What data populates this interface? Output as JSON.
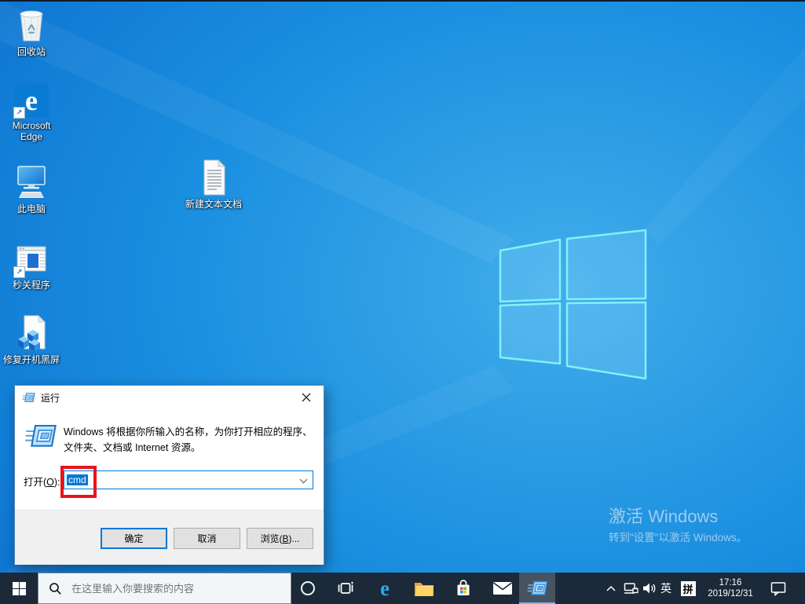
{
  "desktop": {
    "icons": [
      {
        "id": "recycle-bin",
        "label": "回收站"
      },
      {
        "id": "microsoft-edge",
        "label": "Microsoft Edge"
      },
      {
        "id": "this-pc",
        "label": "此电脑"
      },
      {
        "id": "seconds-close-app",
        "label": "秒关程序"
      },
      {
        "id": "fix-boot-black-screen",
        "label": "修复开机黑屏"
      },
      {
        "id": "new-text-document",
        "label": "新建文本文档"
      }
    ],
    "activation_watermark": {
      "line1": "激活 Windows",
      "line2": "转到\"设置\"以激活 Windows。"
    }
  },
  "run_dialog": {
    "title": "运行",
    "message_line1": "Windows 将根据你所输入的名称，为你打开相应的程序、",
    "message_line2": "文件夹、文档或 Internet 资源。",
    "open_label": {
      "prefix": "打开(",
      "key": "O",
      "suffix": "):"
    },
    "input_value": "cmd",
    "buttons": {
      "ok": "确定",
      "cancel": "取消",
      "browse": {
        "prefix": "浏览(",
        "key": "B",
        "suffix": ")..."
      }
    },
    "accent_color": "#0078d7",
    "annotation_color": "#e8151b"
  },
  "taskbar": {
    "search": {
      "placeholder": "在这里输入你要搜索的内容"
    },
    "pinned_icons": [
      "start",
      "search",
      "cortana",
      "task-view",
      "edge",
      "file-explorer",
      "store",
      "mail",
      "run-dialog"
    ],
    "active_app": "run-dialog",
    "tray": {
      "ime_language": "英",
      "ime_mode": "拼",
      "time": "17:16",
      "date": "2019/12/31"
    }
  },
  "colors": {
    "taskbar_bg": "#1b2938",
    "selection_blue": "#0078d7",
    "wallpaper_main": "#1b8fe0",
    "active_task_bg": "#47545f"
  }
}
